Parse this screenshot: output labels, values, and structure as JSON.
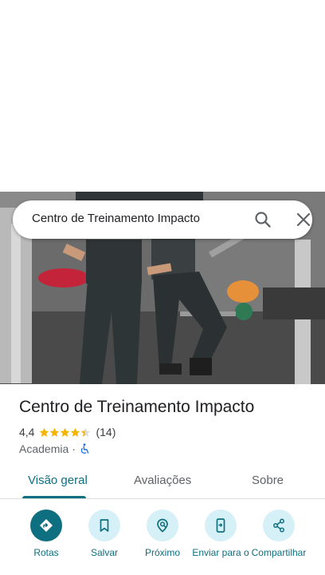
{
  "search": {
    "query": "Centro de Treinamento Impacto",
    "search_icon": "search-icon",
    "close_icon": "close-icon"
  },
  "photo": {
    "icon": "place-photo"
  },
  "place": {
    "title": "Centro de Treinamento Impacto",
    "rating": "4,4",
    "rating_value": 4.4,
    "stars_max": 5,
    "reviews_count": "(14)",
    "category": "Academia",
    "separator": "·",
    "accessibility_icon": "wheelchair-icon"
  },
  "tabs": [
    {
      "label": "Visão geral",
      "selected": true
    },
    {
      "label": "Avaliações",
      "selected": false
    },
    {
      "label": "Sobre",
      "selected": false
    }
  ],
  "actions": [
    {
      "label": "Rotas",
      "icon": "directions-icon"
    },
    {
      "label": "Salvar",
      "icon": "bookmark-icon"
    },
    {
      "label": "Próximo",
      "icon": "nearby-icon"
    },
    {
      "label": "Enviar para o",
      "icon": "send-to-phone-icon"
    },
    {
      "label": "Compartilhar",
      "icon": "share-icon"
    }
  ],
  "colors": {
    "accent": "#0e6f80",
    "action_bg": "#d6f0f7",
    "star": "#f4b400",
    "text_primary": "#202124",
    "text_secondary": "#5f6368",
    "accessibility": "#1a73e8"
  }
}
